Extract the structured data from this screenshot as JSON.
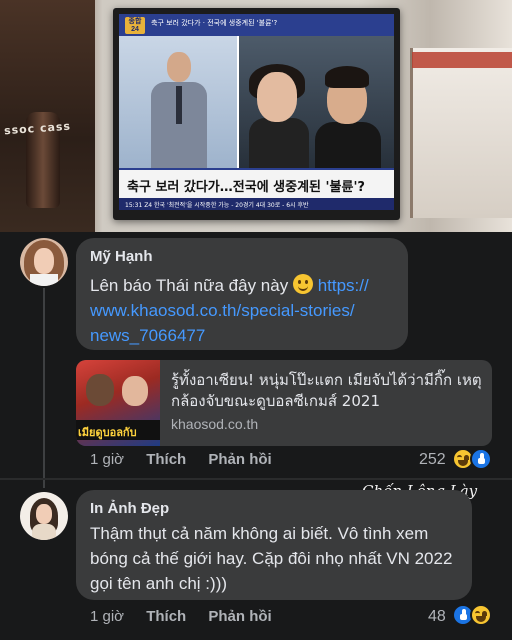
{
  "photo": {
    "bottle_label": "ssoc cass",
    "tv": {
      "logo_text": "종합 24",
      "topbar_text": "축구 보러 갔다가 · 전국에 생중계된 '불륜'?",
      "caption": "축구 보러 갔다가…전국에 생중계된 '불륜'?",
      "ticker": "15:31  Z4  한국 '최전적'을 시작중한 가능 - 20경기 4대 30로 - 6시 후반"
    }
  },
  "comments": [
    {
      "author": "Mỹ Hạnh",
      "text": "Lên báo Thái nữa đây này",
      "link_line1": "https://",
      "link_line2": "www.khaosod.co.th/special-stories/",
      "link_line3": "news_7066477",
      "preview": {
        "image_caption": "เมียดูบอลกับ",
        "title": "รู้ทั้งอาเซียน! หนุ่มโป๊ะแตก เมียจับได้ว่ามีกิ๊ก เหตุกล้องจับขณะดูบอลซีเกมส์ 2021",
        "domain": "khaosod.co.th"
      },
      "time": "1 giờ",
      "like_label": "Thích",
      "reply_label": "Phản hồi",
      "reaction_count": "252",
      "reactions": [
        "haha-icon",
        "like-icon"
      ]
    },
    {
      "author": "In Ảnh Đẹp",
      "text": "Thậm thụt cả năm không ai biết. Vô tình xem bóng cả thế giới hay. Cặp đôi nhọ nhất VN 2022 gọi tên anh chị :)))",
      "time": "1 giờ",
      "like_label": "Thích",
      "reply_label": "Phản hồi",
      "reaction_count": "48",
      "reactions": [
        "like-icon",
        "haha-icon"
      ]
    }
  ],
  "watermark": "Chốn Lông Lày",
  "colors": {
    "background": "#18191a",
    "bubble": "#3a3b3c",
    "text": "#e4e6eb",
    "muted": "#b0b3b8",
    "link": "#4599ff",
    "like_blue": "#1b74e4",
    "haha_yellow": "#f7c531"
  }
}
